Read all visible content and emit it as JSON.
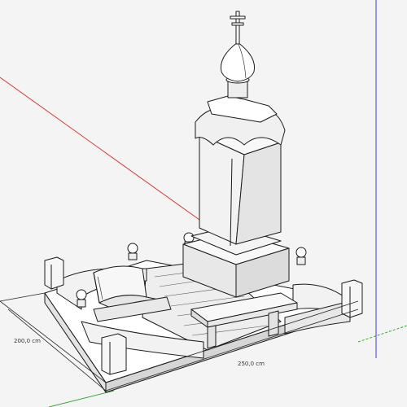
{
  "dimensions": {
    "width_label": "250,0 cm",
    "depth_label": "200,0 cm"
  },
  "axes": {
    "red": "#d23a3a",
    "green": "#3aa63a",
    "blue": "#3a3ad8"
  },
  "model": {
    "subject": "memorial-monument-with-cross",
    "fill": "#ffffff",
    "shade": "#e3e3e3",
    "edge": "#1a1a1a"
  }
}
